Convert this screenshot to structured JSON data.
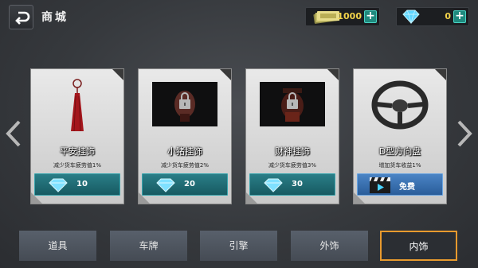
{
  "header": {
    "title": "商城",
    "gold_amount": "1000",
    "gem_amount": "0"
  },
  "items": [
    {
      "name": "平安挂饰",
      "desc": "减少货车疲劳值1%",
      "price": "10",
      "currency": "gem-icon",
      "locked": false
    },
    {
      "name": "小猪挂饰",
      "desc": "减少货车疲劳值2%",
      "price": "20",
      "currency": "gem-icon",
      "locked": true
    },
    {
      "name": "财神挂饰",
      "desc": "减少货车疲劳值3%",
      "price": "30",
      "currency": "gem-icon",
      "locked": true
    },
    {
      "name": "D型方向盘",
      "desc": "增加货车收益1%",
      "price": "免费",
      "currency": "video-icon",
      "locked": false
    }
  ],
  "tabs": [
    {
      "label": "道具",
      "active": false
    },
    {
      "label": "车牌",
      "active": false
    },
    {
      "label": "引擎",
      "active": false
    },
    {
      "label": "外饰",
      "active": false
    },
    {
      "label": "内饰",
      "active": true
    }
  ],
  "colors": {
    "active_tab_border": "#e89a2e",
    "price_button": "#1f6b73",
    "gem": "#5fd6ff",
    "gold_text": "#f1d24a"
  }
}
